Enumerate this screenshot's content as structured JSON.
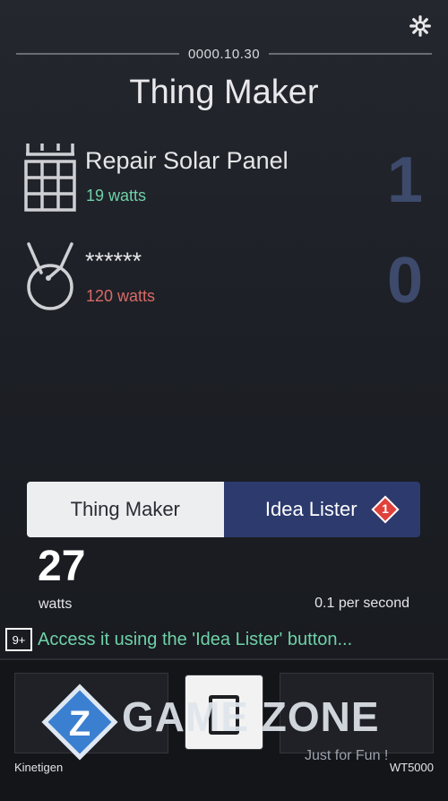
{
  "header": {
    "version": "0000.10.30",
    "title": "Thing Maker",
    "settings_icon": "gear-icon"
  },
  "items": [
    {
      "icon": "grid-panel-icon",
      "name": "Repair Solar Panel",
      "watts": "19 watts",
      "watts_color": "#6fd1a8",
      "count": "1"
    },
    {
      "icon": "hanger-ring-icon",
      "name": "******",
      "watts": "120 watts",
      "watts_color": "#d96a66",
      "count": "0"
    }
  ],
  "tabs": {
    "thing_maker": "Thing Maker",
    "idea_lister": "Idea Lister",
    "idea_lister_badge": "1"
  },
  "power": {
    "amount": "27",
    "unit": "watts",
    "rate": "0.1 per second"
  },
  "hint": {
    "badge": "9+",
    "text": "Access it using the 'Idea Lister' button..."
  },
  "bottom": {
    "left_label": "Kinetigen",
    "right_label": "WT5000"
  },
  "watermark": {
    "text": "GAME ZONE",
    "sub": "Just for Fun !"
  },
  "colors": {
    "accent_tab": "#2c3a6e",
    "count": "#3d4a6c",
    "green": "#6fd1a8",
    "red": "#d96a66",
    "badge": "#e0413b"
  }
}
